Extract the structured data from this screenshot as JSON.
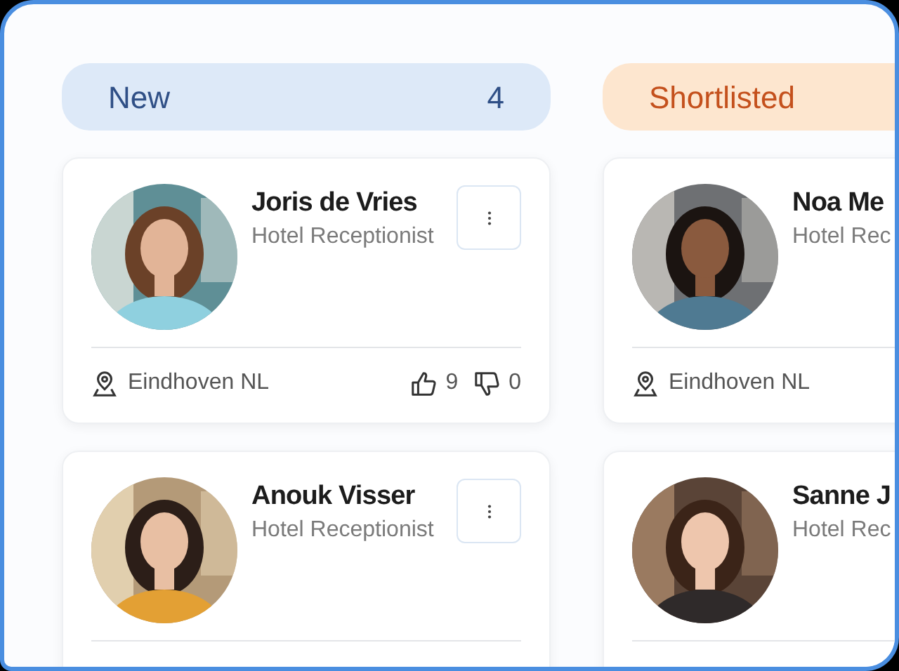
{
  "columns": [
    {
      "kind": "new",
      "title": "New",
      "count": "4",
      "cards": [
        {
          "name": "Joris de Vries",
          "role": "Hotel Receptionist",
          "has_menu": true,
          "location": "Eindhoven NL",
          "likes": "9",
          "dislikes": "0"
        },
        {
          "name": "Anouk Visser",
          "role": "Hotel Receptionist",
          "has_menu": true
        }
      ]
    },
    {
      "kind": "shortlisted",
      "title": "Shortlisted",
      "cards": [
        {
          "name": "Noa Me",
          "role": "Hotel Rec",
          "location": "Eindhoven NL"
        },
        {
          "name": "Sanne J",
          "role": "Hotel Rec"
        }
      ]
    }
  ]
}
